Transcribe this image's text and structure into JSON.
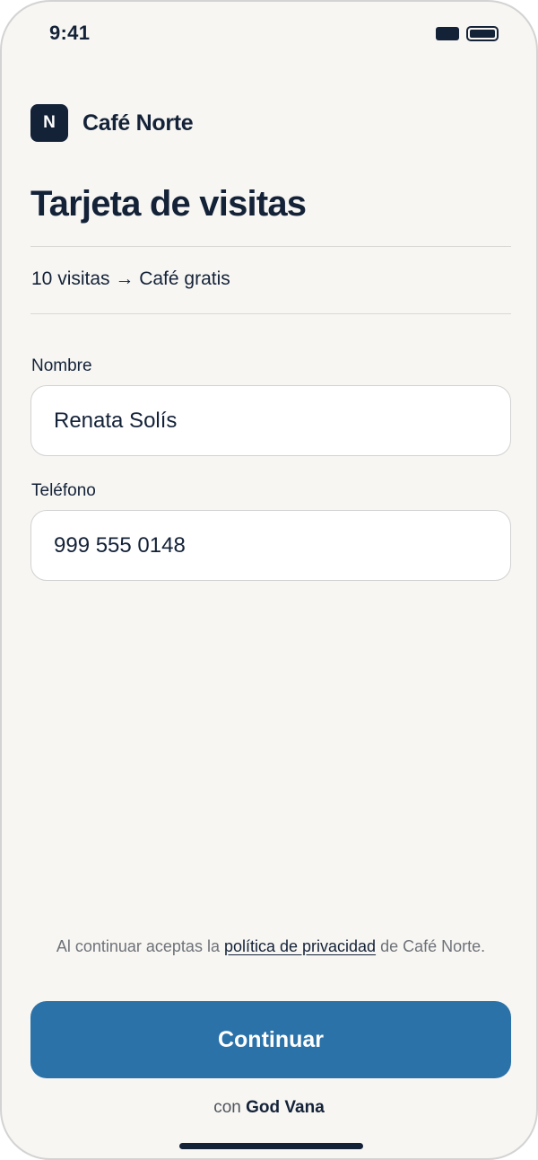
{
  "status_bar": {
    "time": "9:41",
    "icons": [
      "signal-icon",
      "battery-icon"
    ]
  },
  "brand": {
    "logo_letter": "N",
    "name": "Café Norte"
  },
  "page": {
    "title": "Tarjeta de visitas",
    "reward": "10 visitas → Café gratis"
  },
  "form": {
    "name_label": "Nombre",
    "name_value": "Renata Solís",
    "phone_label": "Teléfono",
    "phone_value": "999 555 0148"
  },
  "consent": {
    "prefix": "Al continuar aceptas la ",
    "link": "política de privacidad",
    "suffix": " de Café Norte."
  },
  "actions": {
    "continue_label": "Continuar"
  },
  "footer": {
    "prefix": "con ",
    "brand": "God Vana"
  },
  "colors": {
    "background": "#f7f6f3",
    "primary_text": "#142238",
    "button": "#2b72a8",
    "muted_text": "#6e7278"
  }
}
